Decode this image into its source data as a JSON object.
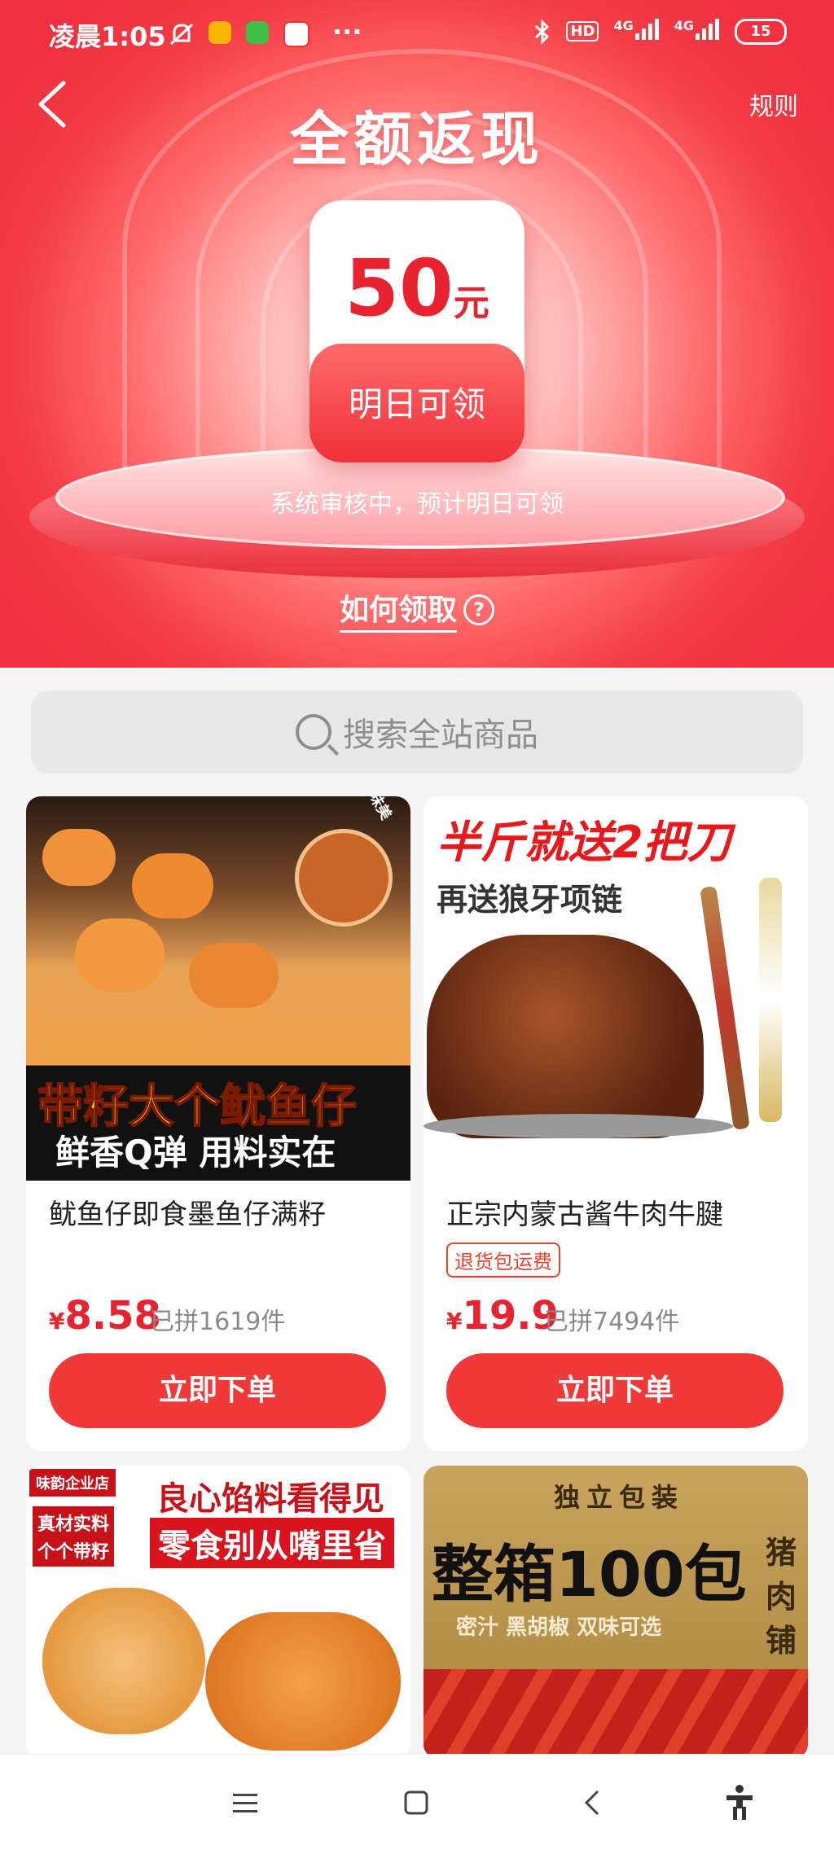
{
  "status": {
    "time": "凌晨1:05",
    "network1": "4G",
    "network2": "4G",
    "hd": "HD",
    "battery": "15"
  },
  "header": {
    "title": "全额返现",
    "rules": "规则"
  },
  "reward": {
    "amount": "50",
    "unit": "元",
    "action": "明日可领",
    "note": "系统审核中，预计明日可领"
  },
  "howto": {
    "label": "如何领取",
    "help": "?"
  },
  "search": {
    "placeholder": "搜索全站商品"
  },
  "products": [
    {
      "name": "鱿鱼仔即食墨鱼仔满籽",
      "currency": "¥",
      "price": "8.58",
      "sold": "已拼1619件",
      "buy": "立即下单",
      "img_main": "带籽大个鱿鱼仔",
      "img_sub": "鲜香Q弹 用料实在",
      "img_badge": "馅足味美"
    },
    {
      "name": "正宗内蒙古酱牛肉牛腱",
      "tag": "退货包运费",
      "currency": "¥",
      "price": "19.9",
      "sold": "已拼7494件",
      "buy": "立即下单",
      "img_main": "半斤就送2把刀",
      "img_sub": "再送狼牙项链"
    },
    {
      "img_corner": "味韵企业店",
      "img_tag1": "真材实料",
      "img_tag2": "个个带籽",
      "img_main": "良心馅料看得见",
      "img_sub": "零食别从嘴里省"
    },
    {
      "img_top": "独立包装",
      "img_main": "整箱100包",
      "img_sub": "密汁 黑胡椒 双味可选",
      "img_side": "猪肉铺"
    }
  ],
  "colors": {
    "brand": "#f03a3a",
    "price": "#e8232f"
  }
}
